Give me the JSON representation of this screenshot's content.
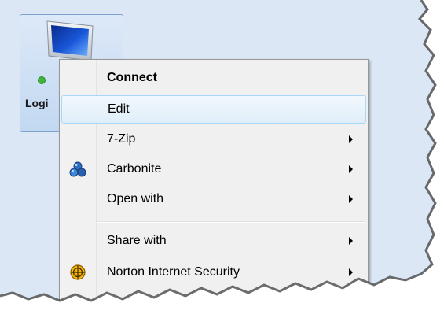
{
  "desktop": {
    "icon": {
      "label": "Logi",
      "status": "online",
      "icon": "monitor-icon",
      "status_color": "#3fb63a"
    }
  },
  "context_menu": {
    "items": [
      {
        "label": "Connect",
        "bold": true,
        "submenu": false,
        "icon": ""
      },
      {
        "label": "Edit",
        "bold": false,
        "submenu": false,
        "icon": "",
        "highlighted": true
      },
      {
        "label": "7-Zip",
        "bold": false,
        "submenu": true,
        "icon": ""
      },
      {
        "label": "Carbonite",
        "bold": false,
        "submenu": true,
        "icon": "carbonite-icon"
      },
      {
        "label": "Open with",
        "bold": false,
        "submenu": true,
        "icon": ""
      },
      {
        "label": "Share with",
        "bold": false,
        "submenu": true,
        "icon": ""
      },
      {
        "label": "Norton Internet Security",
        "bold": false,
        "submenu": true,
        "icon": "norton-icon"
      }
    ]
  },
  "colors": {
    "highlight_border": "#a8d8f8",
    "menu_background": "#f0f0f0",
    "tile_border": "#7da2ce"
  }
}
